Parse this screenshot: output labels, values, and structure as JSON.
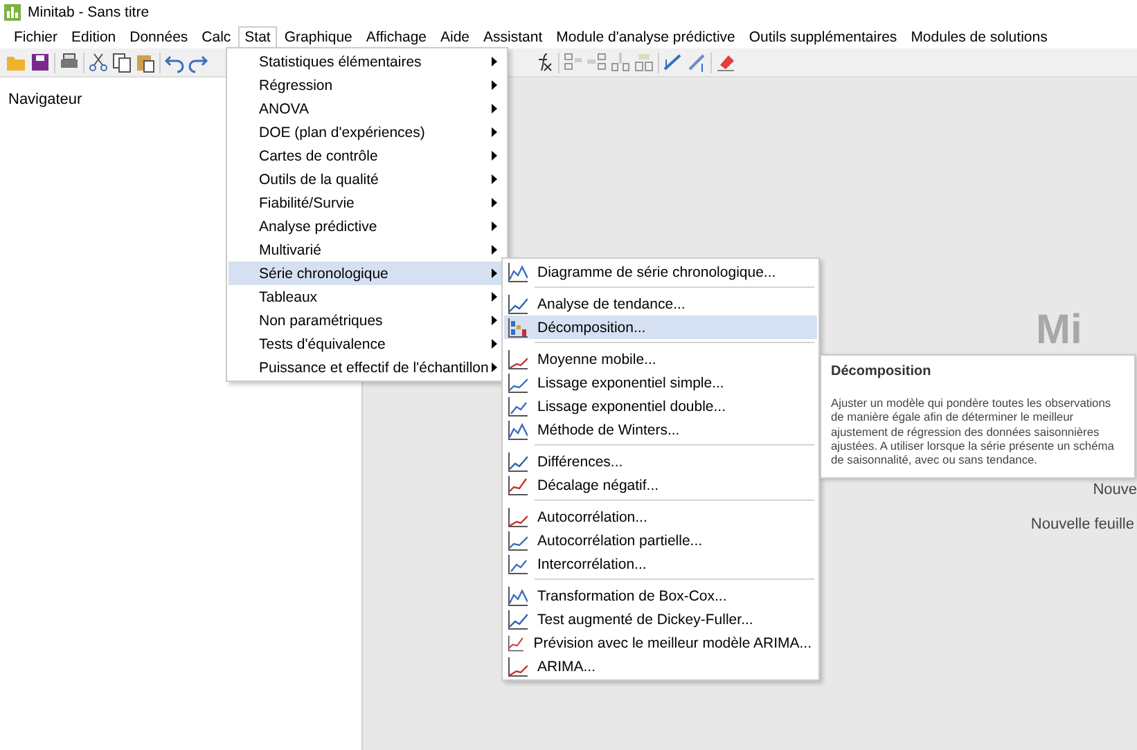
{
  "window": {
    "title": "Minitab - Sans titre"
  },
  "menubar": [
    {
      "label": "Fichier",
      "selected": false
    },
    {
      "label": "Edition",
      "selected": false
    },
    {
      "label": "Données",
      "selected": false
    },
    {
      "label": "Calc",
      "selected": false
    },
    {
      "label": "Stat",
      "selected": true
    },
    {
      "label": "Graphique",
      "selected": false
    },
    {
      "label": "Affichage",
      "selected": false
    },
    {
      "label": "Aide",
      "selected": false
    },
    {
      "label": "Assistant",
      "selected": false
    },
    {
      "label": "Module d'analyse prédictive",
      "selected": false
    },
    {
      "label": "Outils supplémentaires",
      "selected": false
    },
    {
      "label": "Modules de solutions",
      "selected": false
    }
  ],
  "navigator": {
    "title": "Navigateur"
  },
  "start_page": {
    "logo_text": "Mi",
    "links": [
      "Nouve",
      "Nouvelle feuille"
    ]
  },
  "stat_menu": [
    {
      "label": "Statistiques élémentaires",
      "selected": false
    },
    {
      "label": "Régression",
      "selected": false
    },
    {
      "label": "ANOVA",
      "selected": false
    },
    {
      "label": "DOE (plan d'expériences)",
      "selected": false
    },
    {
      "label": "Cartes de contrôle",
      "selected": false
    },
    {
      "label": "Outils de la qualité",
      "selected": false
    },
    {
      "label": "Fiabilité/Survie",
      "selected": false
    },
    {
      "label": "Analyse prédictive",
      "selected": false
    },
    {
      "label": "Multivarié",
      "selected": false
    },
    {
      "label": "Série chronologique",
      "selected": true
    },
    {
      "label": "Tableaux",
      "selected": false
    },
    {
      "label": "Non paramétriques",
      "selected": false
    },
    {
      "label": "Tests d'équivalence",
      "selected": false
    },
    {
      "label": "Puissance et effectif de l'échantillon",
      "selected": false
    }
  ],
  "time_series_menu": [
    [
      {
        "label": "Diagramme de série chronologique...",
        "selected": false
      }
    ],
    [
      {
        "label": "Analyse de tendance...",
        "selected": false
      },
      {
        "label": "Décomposition...",
        "selected": true
      }
    ],
    [
      {
        "label": "Moyenne mobile...",
        "selected": false
      },
      {
        "label": "Lissage exponentiel simple...",
        "selected": false
      },
      {
        "label": "Lissage exponentiel double...",
        "selected": false
      },
      {
        "label": "Méthode de Winters...",
        "selected": false
      }
    ],
    [
      {
        "label": "Différences...",
        "selected": false
      },
      {
        "label": "Décalage négatif...",
        "selected": false
      }
    ],
    [
      {
        "label": "Autocorrélation...",
        "selected": false
      },
      {
        "label": "Autocorrélation partielle...",
        "selected": false
      },
      {
        "label": "Intercorrélation...",
        "selected": false
      }
    ],
    [
      {
        "label": "Transformation de Box-Cox...",
        "selected": false
      },
      {
        "label": "Test augmenté de Dickey-Fuller...",
        "selected": false
      },
      {
        "label": "Prévision avec le meilleur modèle ARIMA...",
        "selected": false
      },
      {
        "label": "ARIMA...",
        "selected": false
      }
    ]
  ],
  "tooltip": {
    "title": "Décomposition",
    "text": "Ajuster un modèle qui pondère toutes les observations de manière égale afin de déterminer le meilleur ajustement de régression des données saisonnières ajustées. A utiliser lorsque la série présente un schéma de saisonnalité, avec ou sans tendance."
  }
}
